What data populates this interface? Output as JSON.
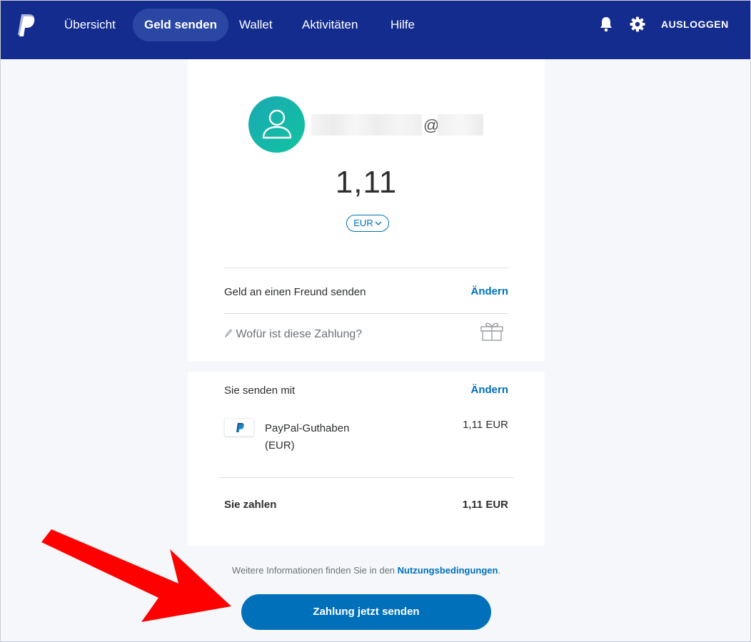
{
  "header": {
    "nav": [
      {
        "label": "Übersicht"
      },
      {
        "label": "Geld senden"
      },
      {
        "label": "Wallet"
      },
      {
        "label": "Aktivitäten"
      },
      {
        "label": "Hilfe"
      }
    ],
    "active_nav": "Geld senden",
    "logout_label": "AUSLOGGEN",
    "icons": [
      "bell-icon",
      "gear-icon"
    ]
  },
  "recipient": {
    "at_symbol": "@"
  },
  "payment": {
    "amount": "1,11",
    "currency": "EUR",
    "type_label": "Geld an einen Freund senden",
    "change_label": "Ändern",
    "note_placeholder": "Wofür ist diese Zahlung?"
  },
  "funding": {
    "title": "Sie senden mit",
    "change_label": "Ändern",
    "source_name": "PayPal-Guthaben",
    "source_currency": "(EUR)",
    "source_amount": "1,11 EUR",
    "total_label": "Sie zahlen",
    "total_amount": "1,11 EUR"
  },
  "footer": {
    "terms_prefix": "Weitere Informationen finden Sie in den ",
    "terms_link": "Nutzungsbedingungen",
    "terms_suffix": ".",
    "send_button": "Zahlung jetzt senden"
  },
  "colors": {
    "header_bg": "#142c8e",
    "active_pill": "#2b47a4",
    "accent": "#0070ba",
    "avatar_from": "#1aa9b3",
    "avatar_to": "#11c3a0",
    "arrow": "#ff0000"
  }
}
